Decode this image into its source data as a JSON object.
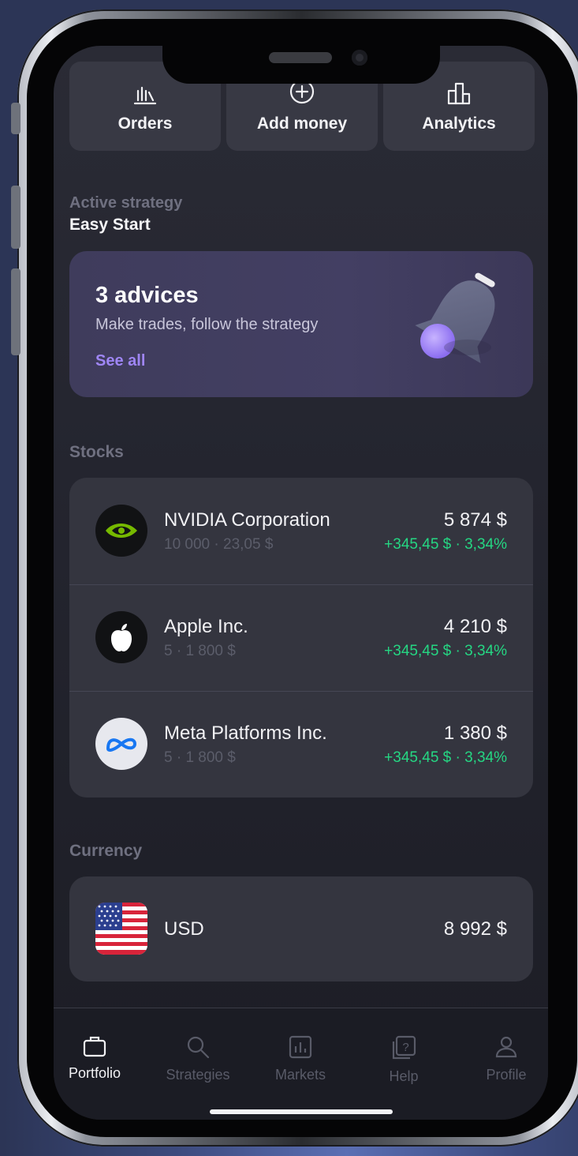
{
  "quick_actions": [
    {
      "label": "Orders",
      "icon": "orders-icon"
    },
    {
      "label": "Add money",
      "icon": "add-circle-icon"
    },
    {
      "label": "Analytics",
      "icon": "analytics-icon"
    }
  ],
  "strategy": {
    "caption": "Active strategy",
    "name": "Easy Start"
  },
  "advice_card": {
    "title": "3 advices",
    "subtitle": "Make trades, follow the strategy",
    "link": "See all",
    "illustration": "bell-icon"
  },
  "stocks": {
    "title": "Stocks",
    "items": [
      {
        "name": "NVIDIA Corporation",
        "sub": "10 000 · 23,05 $",
        "value": "5 874 $",
        "change": "+345,45 $ · 3,34%",
        "logo": "nvidia-logo"
      },
      {
        "name": "Apple Inc.",
        "sub": "5 · 1 800 $",
        "value": "4 210 $",
        "change": "+345,45 $ · 3,34%",
        "logo": "apple-logo"
      },
      {
        "name": "Meta Platforms Inc.",
        "sub": "5 · 1 800 $",
        "value": "1 380 $",
        "change": "+345,45 $ · 3,34%",
        "logo": "meta-logo"
      }
    ]
  },
  "currency": {
    "title": "Currency",
    "items": [
      {
        "name": "USD",
        "value": "8 992 $",
        "flag": "us-flag"
      }
    ]
  },
  "tabbar": {
    "active": "Portfolio",
    "tabs": [
      {
        "label": "Portfolio",
        "icon": "briefcase-icon"
      },
      {
        "label": "Strategies",
        "icon": "search-icon"
      },
      {
        "label": "Markets",
        "icon": "chart-icon"
      },
      {
        "label": "Help",
        "icon": "help-icon"
      },
      {
        "label": "Profile",
        "icon": "profile-icon"
      }
    ]
  },
  "colors": {
    "positive": "#25d783",
    "accent": "#9f86f5",
    "card": "#34353f"
  }
}
